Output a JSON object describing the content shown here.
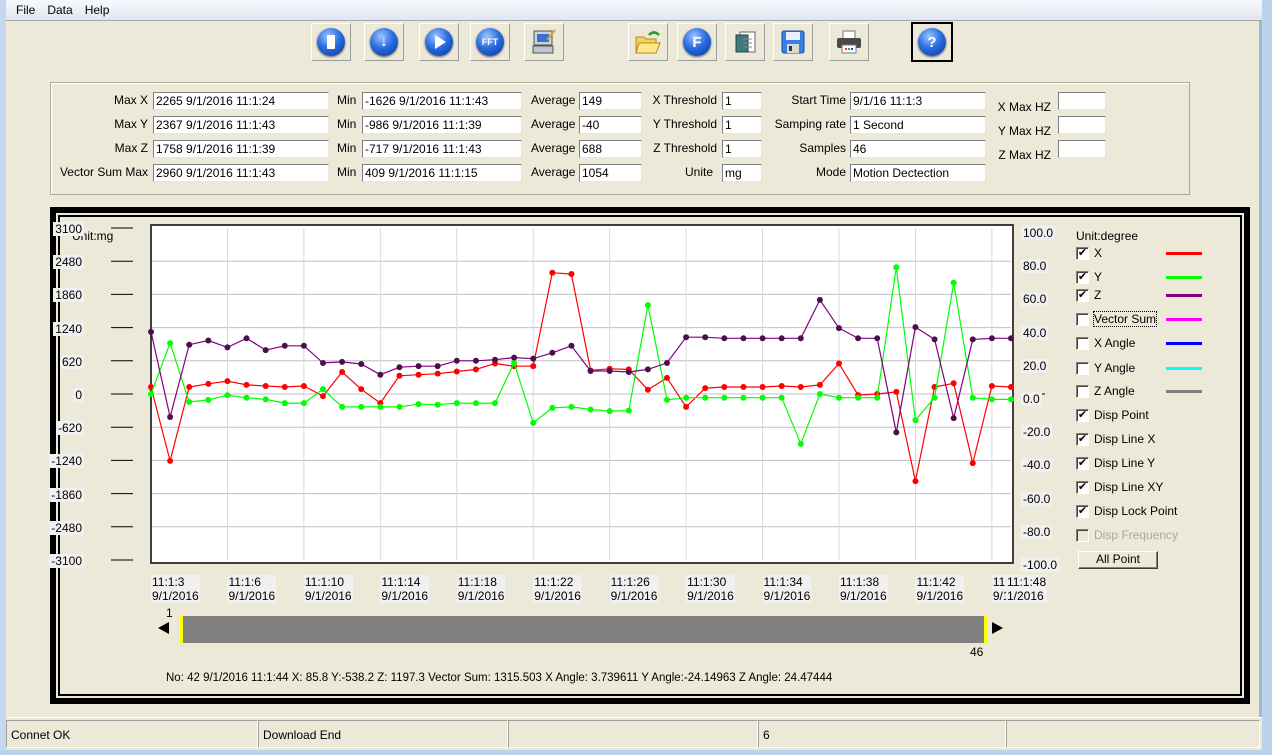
{
  "menu": [
    "File",
    "Data",
    "Help"
  ],
  "toolbar": [
    {
      "name": "stop-button",
      "icon": "stop-icon",
      "label": ""
    },
    {
      "name": "download-button",
      "icon": "download-arrow-icon",
      "label": "↓"
    },
    {
      "name": "play-button",
      "icon": "play-icon",
      "label": ""
    },
    {
      "name": "fft-button",
      "icon": "fft-icon",
      "label": "FFT"
    },
    {
      "name": "configure-device-button",
      "icon": "computer-edit-icon",
      "label": ""
    },
    {
      "name": "open-file-button",
      "icon": "folder-open-icon",
      "label": ""
    },
    {
      "name": "f-button",
      "icon": "f-icon",
      "label": "F"
    },
    {
      "name": "report-button",
      "icon": "document-icon",
      "label": ""
    },
    {
      "name": "save-button",
      "icon": "floppy-disk-icon",
      "label": ""
    },
    {
      "name": "print-button",
      "icon": "printer-icon",
      "label": ""
    },
    {
      "name": "help-button",
      "icon": "help-icon",
      "label": "?"
    }
  ],
  "stats": {
    "max_x_label": "Max X",
    "max_x": "2265   9/1/2016 11:1:24",
    "max_y_label": "Max Y",
    "max_y": "2367   9/1/2016 11:1:43",
    "max_z_label": "Max Z",
    "max_z": "1758   9/1/2016 11:1:39",
    "vsum_max_label": "Vector Sum Max",
    "vsum_max": "2960   9/1/2016 11:1:43",
    "min_label": "Min",
    "min_x": "-1626   9/1/2016 11:1:43",
    "min_y": "-986   9/1/2016 11:1:39",
    "min_z": "-717   9/1/2016 11:1:43",
    "min_vsum": "409   9/1/2016 11:1:15",
    "avg_label": "Average",
    "avg_x": "149",
    "avg_y": "-40",
    "avg_z": "688",
    "avg_vsum": "1054",
    "x_threshold_label": "X Threshold",
    "x_threshold": "1",
    "y_threshold_label": "Y Threshold",
    "y_threshold": "1",
    "z_threshold_label": "Z Threshold",
    "z_threshold": "1",
    "unite_label": "Unite",
    "unite": "mg",
    "start_time_label": "Start Time",
    "start_time": "9/1/16 11:1:3",
    "sampling_rate_label": "Samping rate",
    "sampling_rate": "1 Second",
    "samples_label": "Samples",
    "samples": "46",
    "mode_label": "Mode",
    "mode": "Motion Dectection",
    "x_max_hz_label": "X Max HZ",
    "x_max_hz": "",
    "y_max_hz_label": "Y Max HZ",
    "y_max_hz": "",
    "z_max_hz_label": "Z Max HZ",
    "z_max_hz": ""
  },
  "legend": {
    "unit_label": "Unit:degree",
    "items": [
      {
        "label": "X",
        "checked": true,
        "color": "#ff0000",
        "enabled": true
      },
      {
        "label": "Y",
        "checked": true,
        "color": "#00ff00",
        "enabled": true
      },
      {
        "label": "Z",
        "checked": true,
        "color": "#800080",
        "enabled": true
      },
      {
        "label": "Vector Sum",
        "checked": false,
        "color": "#ff00ff",
        "enabled": true
      },
      {
        "label": "X Angle",
        "checked": false,
        "color": "#0000ff",
        "enabled": true
      },
      {
        "label": "Y Angle",
        "checked": false,
        "color": "#00ffff",
        "enabled": true
      },
      {
        "label": "Z Angle",
        "checked": false,
        "color": "#808080",
        "enabled": true
      }
    ],
    "options": [
      {
        "label": "Disp Point",
        "checked": true,
        "enabled": true
      },
      {
        "label": "Disp Line X",
        "checked": true,
        "enabled": true
      },
      {
        "label": "Disp Line Y",
        "checked": true,
        "enabled": true
      },
      {
        "label": "Disp Line XY",
        "checked": true,
        "enabled": true
      },
      {
        "label": "Disp Lock Point",
        "checked": true,
        "enabled": true
      },
      {
        "label": "Disp Frequency",
        "checked": false,
        "enabled": false
      }
    ],
    "all_point_button": "All Point"
  },
  "slider": {
    "start_label": "1",
    "end_label": "46",
    "range_start": 1,
    "range_end": 46,
    "total": 46
  },
  "readout": "No:  42   9/1/2016   11:1:44  X: 85.8 Y:-538.2 Z: 1197.3 Vector Sum: 1315.503 X Angle: 3.739611 Y Angle:-24.14963 Z Angle: 24.47444",
  "status": [
    "Connet    OK",
    "Download End",
    "",
    "6",
    ""
  ],
  "chart_data": {
    "type": "line",
    "ylabel_left": "Unit:mg",
    "ylabel_right": "Unit:degree",
    "ylim": [
      -3100,
      3100
    ],
    "y2lim": [
      -100,
      100
    ],
    "yticks": [
      "3100",
      "2480",
      "1860",
      "1240",
      "620",
      "0",
      "-620",
      "-1240",
      "-1860",
      "-2480",
      "-3100"
    ],
    "y2ticks": [
      "100.0",
      "80.0",
      "60.0",
      "40.0",
      "20.0",
      "0.0",
      "-20.0",
      "-40.0",
      "-60.0",
      "-80.0",
      "-100.0"
    ],
    "xticks": [
      {
        "index": 0,
        "time": "11:1:3",
        "date": "9/1/2016"
      },
      {
        "index": 4,
        "time": "11:1:6",
        "date": "9/1/2016"
      },
      {
        "index": 8,
        "time": "11:1:10",
        "date": "9/1/2016"
      },
      {
        "index": 12,
        "time": "11:1:14",
        "date": "9/1/2016"
      },
      {
        "index": 16,
        "time": "11:1:18",
        "date": "9/1/2016"
      },
      {
        "index": 20,
        "time": "11:1:22",
        "date": "9/1/2016"
      },
      {
        "index": 24,
        "time": "11:1:26",
        "date": "9/1/2016"
      },
      {
        "index": 28,
        "time": "11:1:30",
        "date": "9/1/2016"
      },
      {
        "index": 32,
        "time": "11:1:34",
        "date": "9/1/2016"
      },
      {
        "index": 36,
        "time": "11:1:38",
        "date": "9/1/2016"
      },
      {
        "index": 40,
        "time": "11:1:42",
        "date": "9/1/2016"
      },
      {
        "index": 44,
        "time": "11:1:46",
        "date": "9/1/2016"
      },
      {
        "index": 45,
        "time": "11:1:48",
        "date": "1/2016"
      }
    ],
    "grid": true,
    "series": [
      {
        "name": "X",
        "color": "#ff0000",
        "values": [
          130,
          -1250,
          130,
          190,
          240,
          170,
          150,
          130,
          150,
          -40,
          410,
          90,
          -170,
          340,
          360,
          380,
          420,
          460,
          570,
          520,
          520,
          2265,
          2240,
          440,
          470,
          460,
          80,
          300,
          -240,
          110,
          130,
          130,
          130,
          150,
          130,
          170,
          570,
          -20,
          0,
          40,
          -1626,
          130,
          200,
          -1290,
          150,
          130
        ]
      },
      {
        "name": "Y",
        "color": "#00ff00",
        "values": [
          0,
          950,
          -150,
          -110,
          -20,
          -70,
          -100,
          -170,
          -170,
          90,
          -240,
          -240,
          -240,
          -240,
          -190,
          -200,
          -170,
          -170,
          -170,
          580,
          -540,
          -260,
          -240,
          -290,
          -320,
          -310,
          1660,
          -110,
          -70,
          -70,
          -70,
          -70,
          -70,
          -70,
          -930,
          0,
          -70,
          -70,
          -70,
          2367,
          -490,
          -70,
          2080,
          -70,
          -100,
          -100
        ]
      },
      {
        "name": "Z",
        "color": "#4b0f4b",
        "values": [
          1160,
          -430,
          920,
          1000,
          870,
          1040,
          820,
          900,
          900,
          580,
          600,
          560,
          360,
          500,
          520,
          520,
          620,
          620,
          640,
          680,
          660,
          770,
          900,
          430,
          430,
          410,
          460,
          580,
          1060,
          1060,
          1040,
          1040,
          1040,
          1040,
          1040,
          1758,
          1230,
          1040,
          1040,
          -717,
          1250,
          1020,
          -450,
          1020,
          1040,
          1040
        ]
      }
    ]
  }
}
